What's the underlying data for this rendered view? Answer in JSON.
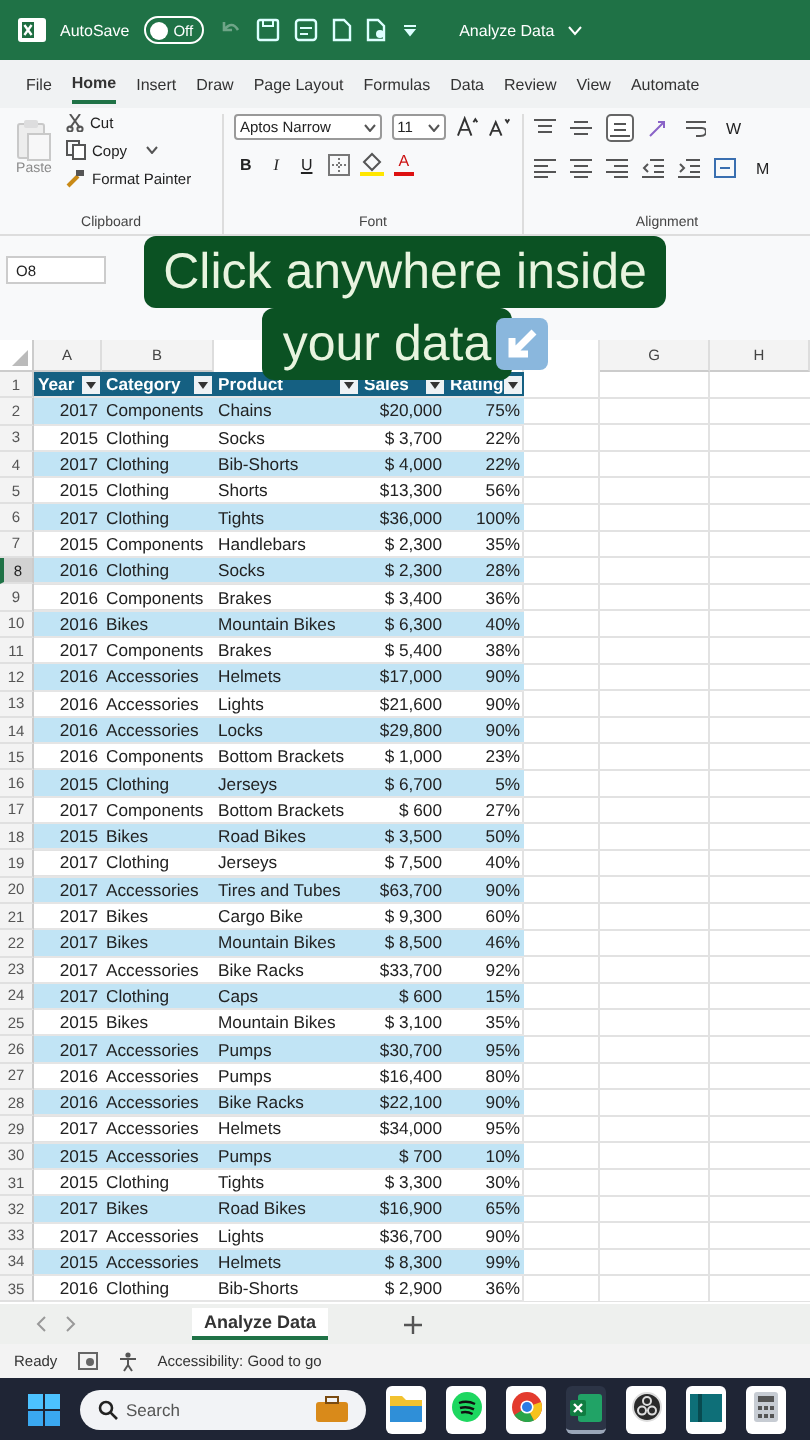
{
  "title_bar": {
    "autosave_label": "AutoSave",
    "autosave": {
      "label": "Off",
      "on": false
    },
    "file_name": "Analyze Data"
  },
  "ribbon_tabs": [
    {
      "label": "File",
      "selected": false
    },
    {
      "label": "Home",
      "selected": true
    },
    {
      "label": "Insert",
      "selected": false
    },
    {
      "label": "Draw",
      "selected": false
    },
    {
      "label": "Page Layout",
      "selected": false
    },
    {
      "label": "Formulas",
      "selected": false
    },
    {
      "label": "Data",
      "selected": false
    },
    {
      "label": "Review",
      "selected": false
    },
    {
      "label": "View",
      "selected": false
    },
    {
      "label": "Automate",
      "selected": false
    }
  ],
  "ribbon": {
    "paste": {
      "label": "Paste",
      "disabled": true
    },
    "cut": "Cut",
    "copy": "Copy",
    "format_painter": "Format Painter",
    "font_name": "Aptos Narrow",
    "font_size": "11",
    "bold": "B",
    "italic": "I",
    "underline": "U",
    "font_color_letter": "A",
    "wrap_text": "W",
    "merge": "M",
    "groups": [
      "Clipboard",
      "Font",
      "Alignment"
    ]
  },
  "name_box": "O8",
  "caption": [
    "Click anywhere inside",
    "your data"
  ],
  "column_headers": [
    "A",
    "B",
    "G",
    "H"
  ],
  "table": {
    "header_row": "1",
    "headers": [
      "Year",
      "Category",
      "Product",
      "Sales",
      "Rating"
    ],
    "rows": [
      {
        "n": "2",
        "year": "2017",
        "category": "Components",
        "product": "Chains",
        "sales": "$20,000",
        "rating": "75%",
        "selected": false
      },
      {
        "n": "3",
        "year": "2015",
        "category": "Clothing",
        "product": "Socks",
        "sales": "$ 3,700",
        "rating": "22%",
        "selected": false
      },
      {
        "n": "4",
        "year": "2017",
        "category": "Clothing",
        "product": "Bib-Shorts",
        "sales": "$ 4,000",
        "rating": "22%",
        "selected": false
      },
      {
        "n": "5",
        "year": "2015",
        "category": "Clothing",
        "product": "Shorts",
        "sales": "$13,300",
        "rating": "56%",
        "selected": false
      },
      {
        "n": "6",
        "year": "2017",
        "category": "Clothing",
        "product": "Tights",
        "sales": "$36,000",
        "rating": "100%",
        "selected": false
      },
      {
        "n": "7",
        "year": "2015",
        "category": "Components",
        "product": "Handlebars",
        "sales": "$ 2,300",
        "rating": "35%",
        "selected": false
      },
      {
        "n": "8",
        "year": "2016",
        "category": "Clothing",
        "product": "Socks",
        "sales": "$ 2,300",
        "rating": "28%",
        "selected": true
      },
      {
        "n": "9",
        "year": "2016",
        "category": "Components",
        "product": "Brakes",
        "sales": "$ 3,400",
        "rating": "36%",
        "selected": false
      },
      {
        "n": "10",
        "year": "2016",
        "category": "Bikes",
        "product": "Mountain Bikes",
        "sales": "$ 6,300",
        "rating": "40%",
        "selected": false
      },
      {
        "n": "11",
        "year": "2017",
        "category": "Components",
        "product": "Brakes",
        "sales": "$ 5,400",
        "rating": "38%",
        "selected": false
      },
      {
        "n": "12",
        "year": "2016",
        "category": "Accessories",
        "product": "Helmets",
        "sales": "$17,000",
        "rating": "90%",
        "selected": false
      },
      {
        "n": "13",
        "year": "2016",
        "category": "Accessories",
        "product": "Lights",
        "sales": "$21,600",
        "rating": "90%",
        "selected": false
      },
      {
        "n": "14",
        "year": "2016",
        "category": "Accessories",
        "product": "Locks",
        "sales": "$29,800",
        "rating": "90%",
        "selected": false
      },
      {
        "n": "15",
        "year": "2016",
        "category": "Components",
        "product": "Bottom Brackets",
        "sales": "$ 1,000",
        "rating": "23%",
        "selected": false
      },
      {
        "n": "16",
        "year": "2015",
        "category": "Clothing",
        "product": "Jerseys",
        "sales": "$ 6,700",
        "rating": "5%",
        "selected": false
      },
      {
        "n": "17",
        "year": "2017",
        "category": "Components",
        "product": "Bottom Brackets",
        "sales": "$ 600",
        "rating": "27%",
        "selected": false
      },
      {
        "n": "18",
        "year": "2015",
        "category": "Bikes",
        "product": "Road Bikes",
        "sales": "$ 3,500",
        "rating": "50%",
        "selected": false
      },
      {
        "n": "19",
        "year": "2017",
        "category": "Clothing",
        "product": "Jerseys",
        "sales": "$ 7,500",
        "rating": "40%",
        "selected": false
      },
      {
        "n": "20",
        "year": "2017",
        "category": "Accessories",
        "product": "Tires and Tubes",
        "sales": "$63,700",
        "rating": "90%",
        "selected": false
      },
      {
        "n": "21",
        "year": "2017",
        "category": "Bikes",
        "product": "Cargo Bike",
        "sales": "$ 9,300",
        "rating": "60%",
        "selected": false
      },
      {
        "n": "22",
        "year": "2017",
        "category": "Bikes",
        "product": "Mountain Bikes",
        "sales": "$ 8,500",
        "rating": "46%",
        "selected": false
      },
      {
        "n": "23",
        "year": "2017",
        "category": "Accessories",
        "product": "Bike Racks",
        "sales": "$33,700",
        "rating": "92%",
        "selected": false
      },
      {
        "n": "24",
        "year": "2017",
        "category": "Clothing",
        "product": "Caps",
        "sales": "$ 600",
        "rating": "15%",
        "selected": false
      },
      {
        "n": "25",
        "year": "2015",
        "category": "Bikes",
        "product": "Mountain Bikes",
        "sales": "$ 3,100",
        "rating": "35%",
        "selected": false
      },
      {
        "n": "26",
        "year": "2017",
        "category": "Accessories",
        "product": "Pumps",
        "sales": "$30,700",
        "rating": "95%",
        "selected": false
      },
      {
        "n": "27",
        "year": "2016",
        "category": "Accessories",
        "product": "Pumps",
        "sales": "$16,400",
        "rating": "80%",
        "selected": false
      },
      {
        "n": "28",
        "year": "2016",
        "category": "Accessories",
        "product": "Bike Racks",
        "sales": "$22,100",
        "rating": "90%",
        "selected": false
      },
      {
        "n": "29",
        "year": "2017",
        "category": "Accessories",
        "product": "Helmets",
        "sales": "$34,000",
        "rating": "95%",
        "selected": false
      },
      {
        "n": "30",
        "year": "2015",
        "category": "Accessories",
        "product": "Pumps",
        "sales": "$ 700",
        "rating": "10%",
        "selected": false
      },
      {
        "n": "31",
        "year": "2015",
        "category": "Clothing",
        "product": "Tights",
        "sales": "$ 3,300",
        "rating": "30%",
        "selected": false
      },
      {
        "n": "32",
        "year": "2017",
        "category": "Bikes",
        "product": "Road Bikes",
        "sales": "$16,900",
        "rating": "65%",
        "selected": false
      },
      {
        "n": "33",
        "year": "2017",
        "category": "Accessories",
        "product": "Lights",
        "sales": "$36,700",
        "rating": "90%",
        "selected": false
      },
      {
        "n": "34",
        "year": "2015",
        "category": "Accessories",
        "product": "Helmets",
        "sales": "$ 8,300",
        "rating": "99%",
        "selected": false
      },
      {
        "n": "35",
        "year": "2016",
        "category": "Clothing",
        "product": "Bib-Shorts",
        "sales": "$ 2,900",
        "rating": "36%",
        "selected": false
      }
    ]
  },
  "sheet_tabs": [
    {
      "label": "Analyze Data",
      "selected": true
    }
  ],
  "status_bar": {
    "mode": "Ready",
    "accessibility": "Accessibility: Good to go"
  },
  "taskbar": {
    "search_placeholder": "Search",
    "apps": [
      {
        "kind": "files",
        "active": false
      },
      {
        "kind": "music",
        "active": false
      },
      {
        "kind": "browser",
        "active": false
      },
      {
        "kind": "excel",
        "active": true
      },
      {
        "kind": "recorder",
        "active": false
      },
      {
        "kind": "panel",
        "active": false
      },
      {
        "kind": "calculator",
        "active": false
      }
    ]
  }
}
